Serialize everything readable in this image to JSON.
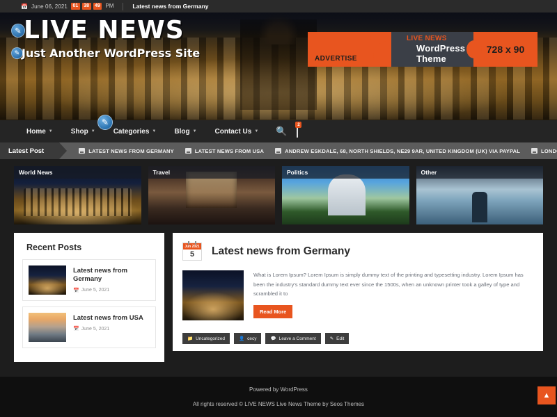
{
  "topbar": {
    "calendar_icon": "calendar-icon",
    "date": "June 06, 2021",
    "clock": {
      "hours": "01",
      "minutes": "38",
      "seconds": "49",
      "ampm": "PM"
    },
    "headline": "Latest news from Germany"
  },
  "header": {
    "logo_badge_icon": "wordpress-icon",
    "logo_title": "LIVE NEWS",
    "tagline_badge_icon": "wordpress-icon",
    "tagline": "Just Another WordPress Site",
    "ad": {
      "advertise_label": "ADVERTISE",
      "brand": "LIVE NEWS",
      "subtitle": "WordPress Theme",
      "size": "728 x 90",
      "accent": "#e8551f"
    }
  },
  "nav": {
    "items": [
      {
        "label": "Home",
        "has_dropdown": true
      },
      {
        "label": "Shop",
        "has_dropdown": true
      },
      {
        "label": "Categories",
        "has_dropdown": true
      },
      {
        "label": "Blog",
        "has_dropdown": true
      },
      {
        "label": "Contact Us",
        "has_dropdown": true
      }
    ],
    "search_icon": "search-icon",
    "cart_icon": "cart-icon",
    "cart_count": "2",
    "cursor_icon": "cursor-pointer-icon"
  },
  "ticker": {
    "label": "Latest Post",
    "items": [
      "LATEST NEWS FROM GERMANY",
      "LATEST NEWS FROM USA",
      "ANDREW ESKDALE, 68, NORTH SHIELDS, NE29 9AR, UNITED KINGDOM (UK) VIA PAYPAL",
      "LONDON NEWS FROM"
    ]
  },
  "category_cards": [
    {
      "label": "World News"
    },
    {
      "label": "Travel"
    },
    {
      "label": "Politics"
    },
    {
      "label": "Other"
    }
  ],
  "sidebar": {
    "title": "Recent Posts",
    "posts": [
      {
        "title": "Latest news from Germany",
        "date": "June 5, 2021",
        "date_icon": "calendar-icon"
      },
      {
        "title": "Latest news from USA",
        "date": "June 5, 2021",
        "date_icon": "calendar-icon"
      }
    ]
  },
  "article": {
    "calendar": {
      "month_year": "Jun 2021",
      "day": "5"
    },
    "title": "Latest news from Germany",
    "excerpt": "What is Lorem Ipsum? Lorem Ipsum is simply dummy text of the printing and typesetting industry. Lorem Ipsum has been the industry's standard dummy text ever since the 1500s, when an unknown printer took a galley of type and scrambled it to",
    "read_more": "Read More",
    "meta": [
      {
        "icon": "folder-icon",
        "label": "Uncategorized"
      },
      {
        "icon": "user-icon",
        "label": "cecy"
      },
      {
        "icon": "comment-icon",
        "label": "Leave a Comment"
      },
      {
        "icon": "pencil-icon",
        "label": "Edit"
      }
    ]
  },
  "footer": {
    "powered_by": "Powered by WordPress",
    "copyright": "All rights reserved © LIVE NEWS Live News Theme by Seos Themes",
    "to_top_icon": "chevron-up-icon"
  }
}
